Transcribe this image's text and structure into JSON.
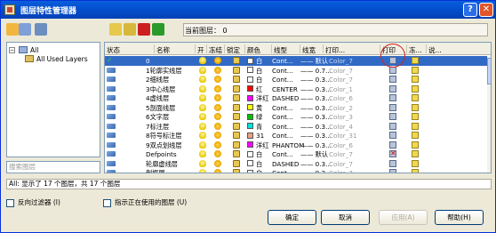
{
  "window": {
    "title": "图层特性管理器",
    "help_glyph": "?",
    "close_glyph": "✕"
  },
  "toolbar": {
    "tools": [
      {
        "name": "new-filter-icon",
        "color": "#f2b640"
      },
      {
        "name": "group-filter-icon",
        "color": "#7fa0d8"
      },
      {
        "name": "state-manager-icon",
        "color": "#6c8fc0"
      },
      {
        "name": "new-layer-icon",
        "color": "#e6c84a"
      },
      {
        "name": "new-layer-frozen-icon",
        "color": "#d6b83a"
      },
      {
        "name": "delete-layer-icon",
        "color": "#cc2020"
      },
      {
        "name": "set-current-icon",
        "color": "#2a9a2a"
      }
    ],
    "current_layer_label": "当前图层： 0"
  },
  "tree": {
    "all_label": "All",
    "all_used_label": "All Used Layers",
    "expand_glyph": "−"
  },
  "search_placeholder": "搜索图层",
  "columns": [
    "状态",
    "名称",
    "开",
    "冻结",
    "锁定",
    "颜色",
    "线型",
    "线宽",
    "打印...",
    "打印",
    "冻...",
    "说..."
  ],
  "layers": [
    {
      "name": "0",
      "color_name": "白",
      "color": "#ffffff",
      "linetype": "Cont...",
      "lineweight": "—— 默认",
      "plot_style": "Color_7",
      "current": true,
      "plot": true
    },
    {
      "name": "1轮廓实线层",
      "color_name": "白",
      "color": "#ffffff",
      "linetype": "Cont...",
      "lineweight": "—— 0.7...",
      "plot_style": "Color_7",
      "current": false,
      "plot": true
    },
    {
      "name": "2细线层",
      "color_name": "白",
      "color": "#ffffff",
      "linetype": "Cont...",
      "lineweight": "—— 0.3...",
      "plot_style": "Color_7",
      "current": false,
      "plot": true
    },
    {
      "name": "3中心线层",
      "color_name": "红",
      "color": "#ff0000",
      "linetype": "CENTER",
      "lineweight": "—— 0.3...",
      "plot_style": "Color_1",
      "current": false,
      "plot": true
    },
    {
      "name": "4虚线层",
      "color_name": "洋红",
      "color": "#ff00ff",
      "linetype": "DASHED",
      "lineweight": "—— 0.3...",
      "plot_style": "Color_6",
      "current": false,
      "plot": true
    },
    {
      "name": "5剖面线层",
      "color_name": "黄",
      "color": "#ffff00",
      "linetype": "Cont...",
      "lineweight": "—— 0.3...",
      "plot_style": "Color_2",
      "current": false,
      "plot": true
    },
    {
      "name": "6文字层",
      "color_name": "绿",
      "color": "#00c000",
      "linetype": "Cont...",
      "lineweight": "—— 0.3...",
      "plot_style": "Color_3",
      "current": false,
      "plot": true
    },
    {
      "name": "7标注层",
      "color_name": "青",
      "color": "#00e0e0",
      "linetype": "Cont...",
      "lineweight": "—— 0.3...",
      "plot_style": "Color_4",
      "current": false,
      "plot": true
    },
    {
      "name": "8符号标注层",
      "color_name": "31",
      "color": "#e8a080",
      "linetype": "Cont...",
      "lineweight": "—— 0.3...",
      "plot_style": "Color_31",
      "current": false,
      "plot": true
    },
    {
      "name": "9双点划线层",
      "color_name": "洋红",
      "color": "#ff00ff",
      "linetype": "PHANTOM",
      "lineweight": "—— 0.3...",
      "plot_style": "Color_6",
      "current": false,
      "plot": true
    },
    {
      "name": "Defpoints",
      "color_name": "白",
      "color": "#ffffff",
      "linetype": "Cont...",
      "lineweight": "—— 默认",
      "plot_style": "Color_7",
      "current": false,
      "plot": false
    },
    {
      "name": "轮廓虚线层",
      "color_name": "白",
      "color": "#ffffff",
      "linetype": "DASHED",
      "lineweight": "—— 0.3...",
      "plot_style": "Color_7",
      "current": false,
      "plot": true
    },
    {
      "name": "剖框层",
      "color_name": "白",
      "color": "#ffffff",
      "linetype": "Cont...",
      "lineweight": "—— 0.3...",
      "plot_style": "Color_7",
      "current": false,
      "plot": true
    }
  ],
  "status_text": "All: 显示了 17 个图层，共 17 个图层",
  "options": {
    "invert_filter": "反向过滤器 (I)",
    "show_in_use": "指示正在使用的图层 (U)"
  },
  "buttons": {
    "ok": "确定",
    "cancel": "取消",
    "apply": "应用(A)",
    "help": "帮助(H)"
  }
}
